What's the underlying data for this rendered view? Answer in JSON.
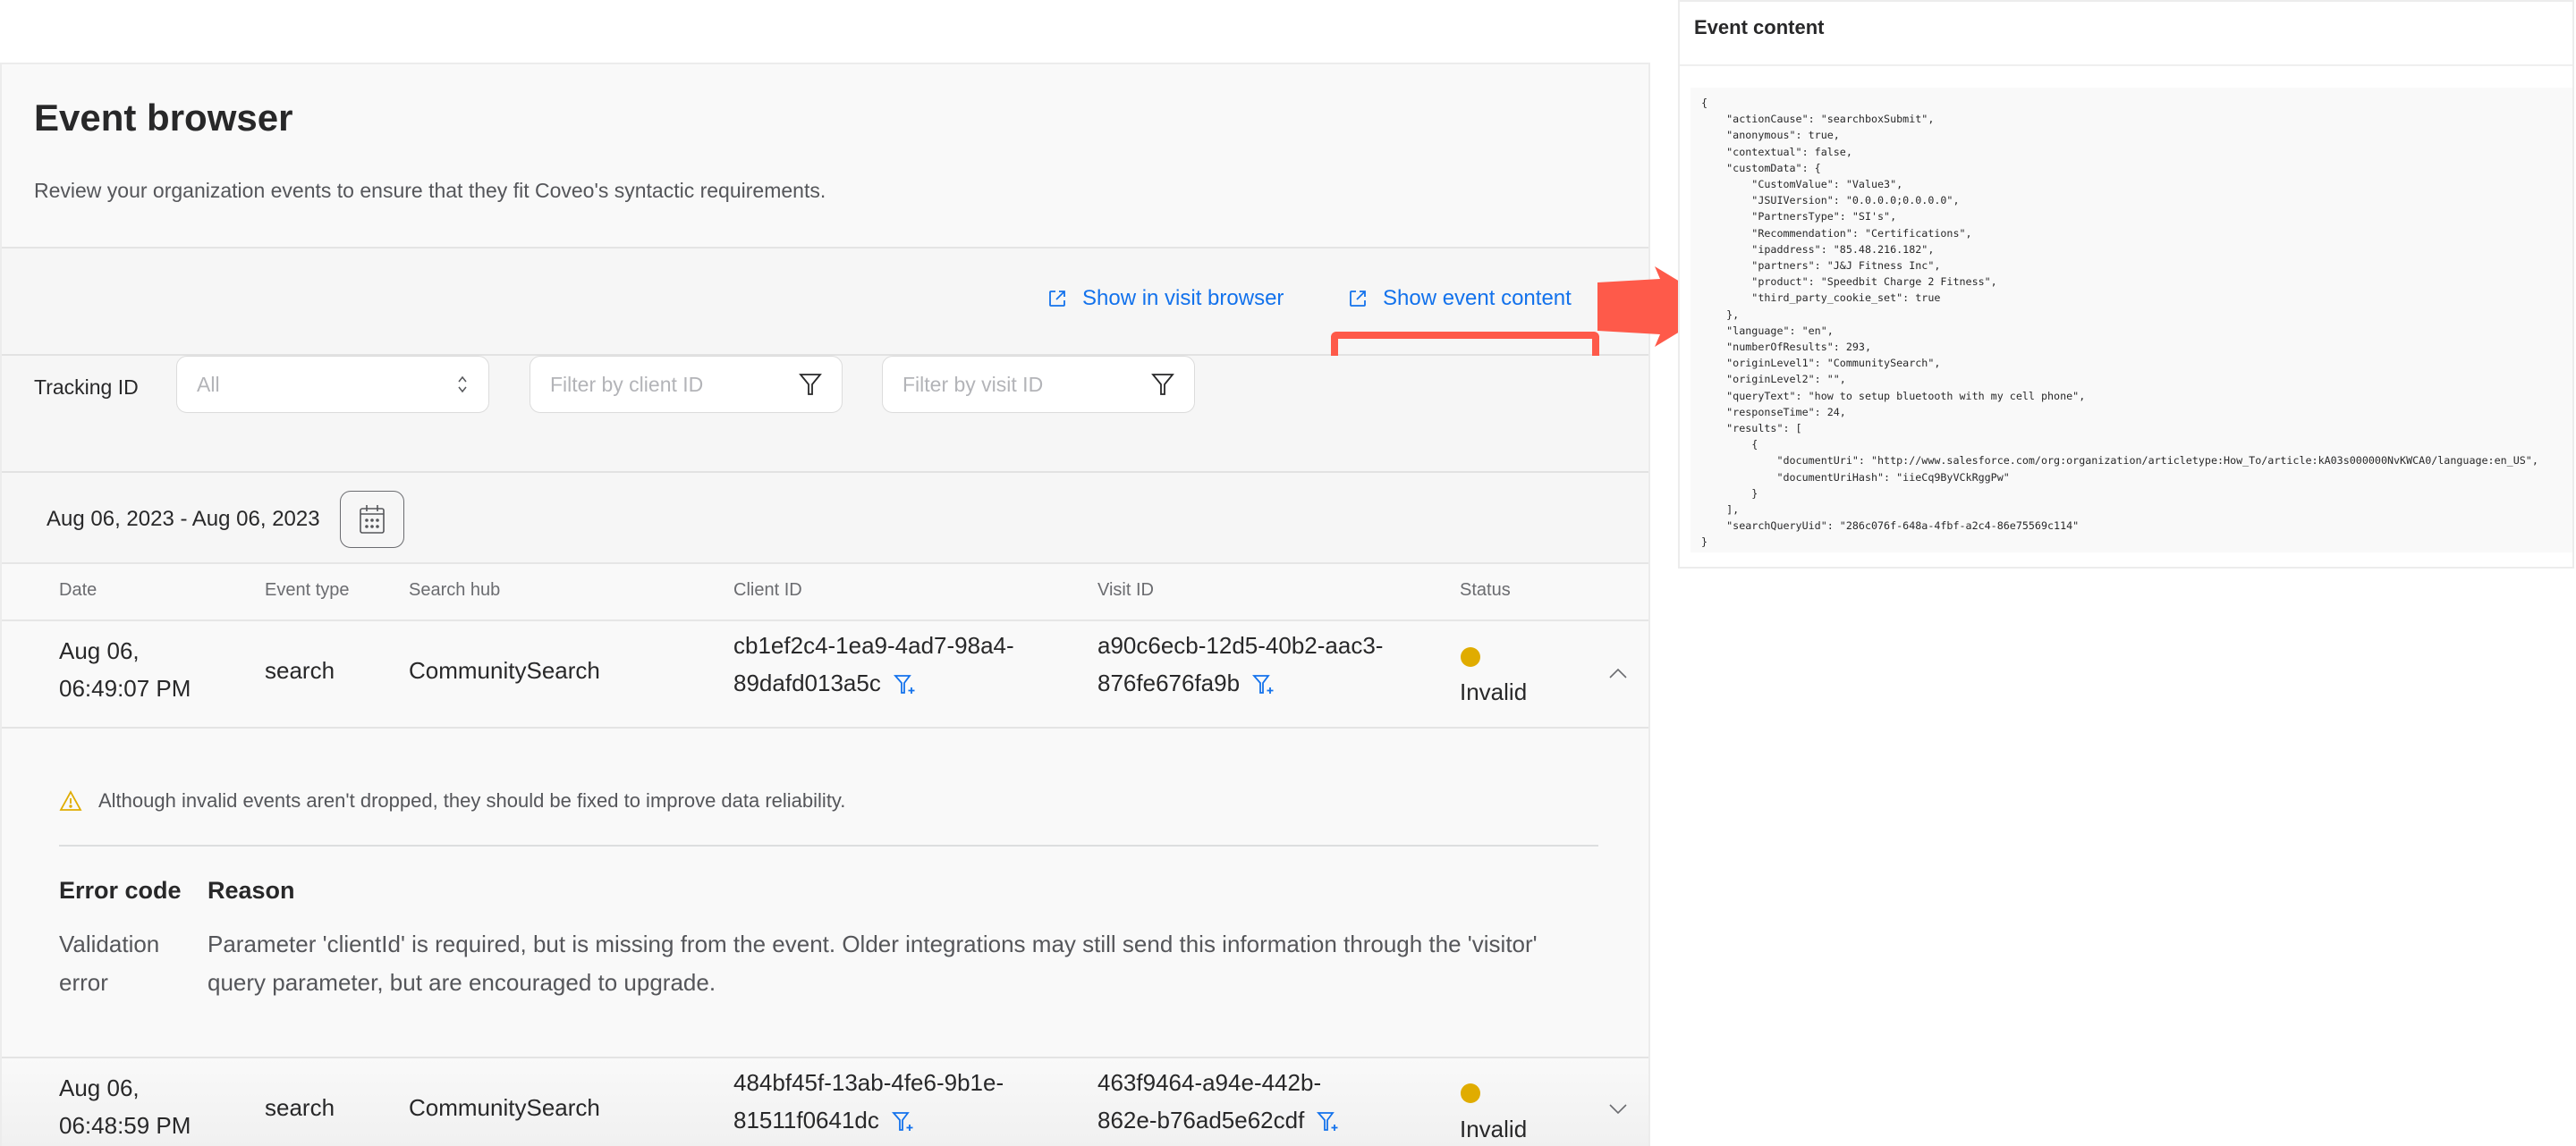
{
  "page": {
    "title": "Event browser",
    "description": "Review your organization events to ensure that they fit Coveo's syntactic requirements."
  },
  "toolbar": {
    "show_in_visit_browser": "Show in visit browser",
    "show_event_content": "Show event content"
  },
  "filters": {
    "tracking_label": "Tracking ID",
    "tracking_value": "All",
    "client_placeholder": "Filter by client ID",
    "visit_placeholder": "Filter by visit ID"
  },
  "date_range": "Aug 06, 2023 - Aug 06, 2023",
  "table": {
    "headers": [
      "Date",
      "Event type",
      "Search hub",
      "Client ID",
      "Visit ID",
      "Status"
    ],
    "rows": [
      {
        "date_line1": "Aug 06,",
        "date_line2": "06:49:07 PM",
        "event_type": "search",
        "search_hub": "CommunitySearch",
        "client_id_line1": "cb1ef2c4-1ea9-4ad7-98a4-",
        "client_id_line2": "89dafd013a5c",
        "visit_id_line1": "a90c6ecb-12d5-40b2-aac3-",
        "visit_id_line2": "876fe676fa9b",
        "status": "Invalid",
        "status_color": "#e0ac00",
        "expanded": true
      },
      {
        "date_line1": "Aug 06,",
        "date_line2": "06:48:59 PM",
        "event_type": "search",
        "search_hub": "CommunitySearch",
        "client_id_line1": "484bf45f-13ab-4fe6-9b1e-",
        "client_id_line2": "81511f0641dc",
        "visit_id_line1": "463f9464-a94e-442b-",
        "visit_id_line2": "862e-b76ad5e62cdf",
        "status": "Invalid",
        "status_color": "#e0ac00",
        "expanded": false
      }
    ]
  },
  "expanded_detail": {
    "warning": "Although invalid events aren't dropped, they should be fixed to improve data reliability.",
    "headers": [
      "Error code",
      "Reason"
    ],
    "errors": [
      {
        "code_line1": "Validation",
        "code_line2": "error",
        "reason_line1": "Parameter 'clientId' is required, but is missing from the event. Older integrations may still send this information through the 'visitor'",
        "reason_line2": "query parameter, but are encouraged to upgrade."
      }
    ]
  },
  "event_content": {
    "title": "Event content",
    "json_text": "{\n    \"actionCause\": \"searchboxSubmit\",\n    \"anonymous\": true,\n    \"contextual\": false,\n    \"customData\": {\n        \"CustomValue\": \"Value3\",\n        \"JSUIVersion\": \"0.0.0.0;0.0.0.0\",\n        \"PartnersType\": \"SI's\",\n        \"Recommendation\": \"Certifications\",\n        \"ipaddress\": \"85.48.216.182\",\n        \"partners\": \"J&J Fitness Inc\",\n        \"product\": \"Speedbit Charge 2 Fitness\",\n        \"third_party_cookie_set\": true\n    },\n    \"language\": \"en\",\n    \"numberOfResults\": 293,\n    \"originLevel1\": \"CommunitySearch\",\n    \"originLevel2\": \"\",\n    \"queryText\": \"how to setup bluetooth with my cell phone\",\n    \"responseTime\": 24,\n    \"results\": [\n        {\n            \"documentUri\": \"http://www.salesforce.com/org:organization/articletype:How_To/article:kA03s000000NvKWCA0/language:en_US\",\n            \"documentUriHash\": \"iieCq9ByVCkRggPw\"\n        }\n    ],\n    \"searchQueryUid\": \"286c076f-648a-4fbf-a2c4-86e75569c114\"\n}"
  },
  "colors": {
    "link": "#1372ec",
    "annotation": "#fe5a4a",
    "status_invalid": "#e0ac00"
  }
}
